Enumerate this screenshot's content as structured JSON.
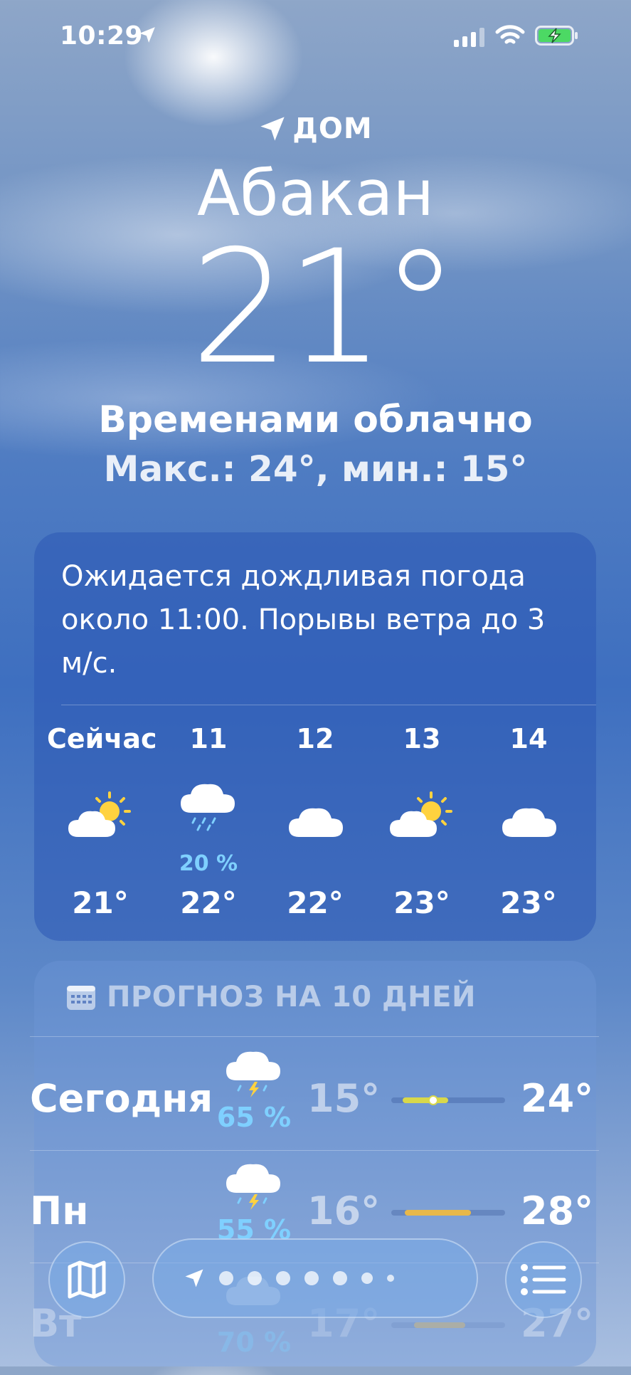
{
  "status_bar": {
    "time": "10:29"
  },
  "location": {
    "home_label": "ДОМ",
    "city": "Абакан",
    "temperature": "21°",
    "condition": "Временами облачно",
    "hilo": "Макс.: 24°, мин.: 15°"
  },
  "hourly": {
    "summary": "Ожидается дождливая погода около 11:00. Порывы ветра до 3 м/с.",
    "hours": [
      {
        "label": "Сейчас",
        "icon": "partly-cloudy-icon",
        "pct": "",
        "temp": "21°"
      },
      {
        "label": "11",
        "icon": "rain-cloud-icon",
        "pct": "20 %",
        "temp": "22°"
      },
      {
        "label": "12",
        "icon": "cloud-icon",
        "pct": "",
        "temp": "22°"
      },
      {
        "label": "13",
        "icon": "partly-cloudy-icon",
        "pct": "",
        "temp": "23°"
      },
      {
        "label": "14",
        "icon": "cloud-icon",
        "pct": "",
        "temp": "23°"
      }
    ]
  },
  "ten_day": {
    "title": "ПРОГНОЗ НА 10 ДНЕЙ",
    "days": [
      {
        "name": "Сегодня",
        "icon": "thunderstorm-icon",
        "pct": "65 %",
        "low": "15°",
        "high": "24°",
        "bar_start": 0.1,
        "bar_end": 0.5,
        "current": 0.37,
        "bar_color": "#d8d84a"
      },
      {
        "name": "Пн",
        "icon": "thunderstorm-icon",
        "pct": "55 %",
        "low": "16°",
        "high": "28°",
        "bar_start": 0.12,
        "bar_end": 0.7,
        "bar_color": "#e8b84a"
      },
      {
        "name": "Вт",
        "icon": "rain-cloud-icon",
        "pct": "70 %",
        "low": "17°",
        "high": "27°",
        "bar_start": 0.2,
        "bar_end": 0.65,
        "bar_color": "#e8b84a"
      }
    ]
  },
  "bottom_bar": {
    "map_button": "map-icon",
    "list_button": "list-icon",
    "page_count": 7
  }
}
